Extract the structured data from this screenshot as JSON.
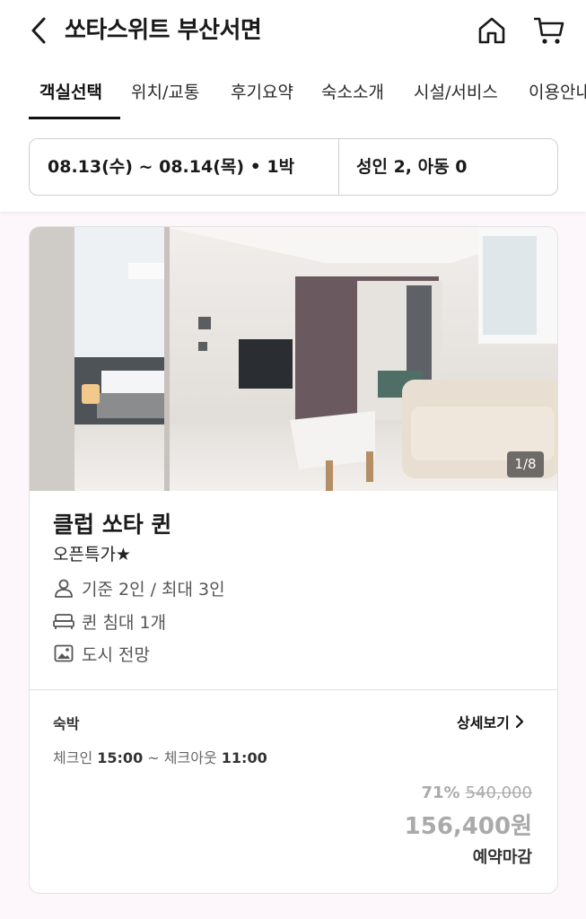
{
  "header": {
    "title": "쏘타스위트 부산서면",
    "icons": {
      "back": "chevron-left-icon",
      "home": "home-icon",
      "cart": "cart-icon"
    }
  },
  "tabs": [
    {
      "label": "객실선택",
      "active": true
    },
    {
      "label": "위치/교통"
    },
    {
      "label": "후기요약"
    },
    {
      "label": "숙소소개"
    },
    {
      "label": "시설/서비스"
    },
    {
      "label": "이용안내"
    }
  ],
  "search": {
    "dates": "08.13(수) ~ 08.14(목) • 1박",
    "guests": "성인 2, 아동 0"
  },
  "room": {
    "photo_counter": "1/8",
    "name": "클럽 쏘타 퀸",
    "promo": "오픈특가★",
    "features": [
      {
        "icon": "person-icon",
        "text": "기준 2인 / 최대 3인"
      },
      {
        "icon": "bed-icon",
        "text": "퀸 침대 1개"
      },
      {
        "icon": "image-icon",
        "text": "도시 전망"
      }
    ],
    "stay_type": "숙박",
    "detail_link": "상세보기",
    "checkin_label": "체크인",
    "checkin_time": "15:00",
    "checkin_sep": "~",
    "checkout_label": "체크아웃",
    "checkout_time": "11:00",
    "discount": "71%",
    "original_price": "540,000",
    "price": "156,400원",
    "status": "예약마감"
  },
  "colors": {
    "accent": "#111111",
    "muted_price": "#aaaaaa",
    "page_bg": "#fdf7fb"
  }
}
